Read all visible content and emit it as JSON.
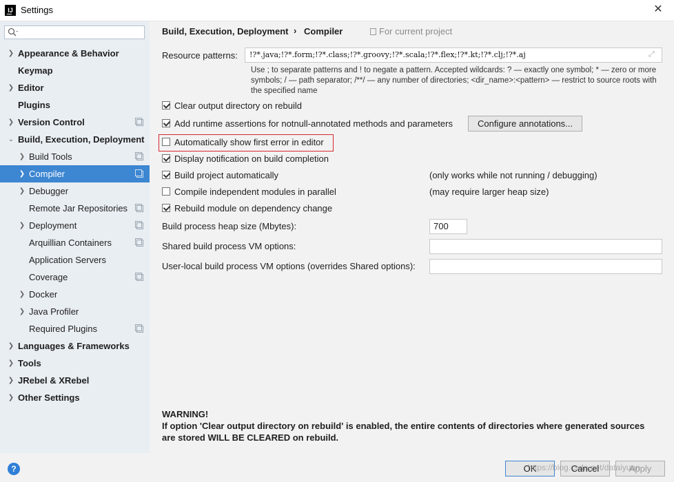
{
  "window": {
    "title": "Settings",
    "app_icon": "IJ"
  },
  "search": {
    "placeholder": ""
  },
  "sidebar": {
    "items": [
      {
        "label": "Appearance & Behavior"
      },
      {
        "label": "Keymap"
      },
      {
        "label": "Editor"
      },
      {
        "label": "Plugins"
      },
      {
        "label": "Version Control"
      },
      {
        "label": "Build, Execution, Deployment"
      },
      {
        "label": "Build Tools"
      },
      {
        "label": "Compiler"
      },
      {
        "label": "Debugger"
      },
      {
        "label": "Remote Jar Repositories"
      },
      {
        "label": "Deployment"
      },
      {
        "label": "Arquillian Containers"
      },
      {
        "label": "Application Servers"
      },
      {
        "label": "Coverage"
      },
      {
        "label": "Docker"
      },
      {
        "label": "Java Profiler"
      },
      {
        "label": "Required Plugins"
      },
      {
        "label": "Languages & Frameworks"
      },
      {
        "label": "Tools"
      },
      {
        "label": "JRebel & XRebel"
      },
      {
        "label": "Other Settings"
      }
    ]
  },
  "breadcrumb": {
    "parent": "Build, Execution, Deployment",
    "separator": "›",
    "current": "Compiler",
    "scope": "For current project"
  },
  "resource": {
    "label": "Resource patterns:",
    "value": "!?*.java;!?*.form;!?*.class;!?*.groovy;!?*.scala;!?*.flex;!?*.kt;!?*.clj;!?*.aj",
    "hint": "Use ; to separate patterns and ! to negate a pattern. Accepted wildcards: ? — exactly one symbol; * — zero or more symbols; / — path separator; /**/ — any number of directories; <dir_name>:<pattern> — restrict to source roots with the specified name"
  },
  "options": {
    "clear_output": "Clear output directory on rebuild",
    "runtime_assertions": "Add runtime assertions for notnull-annotated methods and parameters",
    "configure_annotations": "Configure annotations...",
    "auto_show_error": "Automatically show first error in editor",
    "display_notification": "Display notification on build completion",
    "build_auto": "Build project automatically",
    "build_auto_note": "(only works while not running / debugging)",
    "compile_parallel": "Compile independent modules in parallel",
    "compile_parallel_note": "(may require larger heap size)",
    "rebuild_dependency": "Rebuild module on dependency change"
  },
  "fields": {
    "heap_label": "Build process heap size (Mbytes):",
    "heap_value": "700",
    "shared_label": "Shared build process VM options:",
    "shared_value": "",
    "local_label": "User-local build process VM options (overrides Shared options):",
    "local_value": ""
  },
  "warning": {
    "title": "WARNING!",
    "text": "If option 'Clear output directory on rebuild' is enabled, the entire contents of directories where generated sources are stored WILL BE CLEARED on rebuild."
  },
  "buttons": {
    "help": "?",
    "ok": "OK",
    "cancel": "Cancel",
    "apply": "Apply"
  },
  "watermark": "https://blog.csdn.net/dataiyuan",
  "colors": {
    "selection": "#3d86d1",
    "sidebar_bg": "#e9eef3",
    "highlight_border": "#d9262b"
  }
}
